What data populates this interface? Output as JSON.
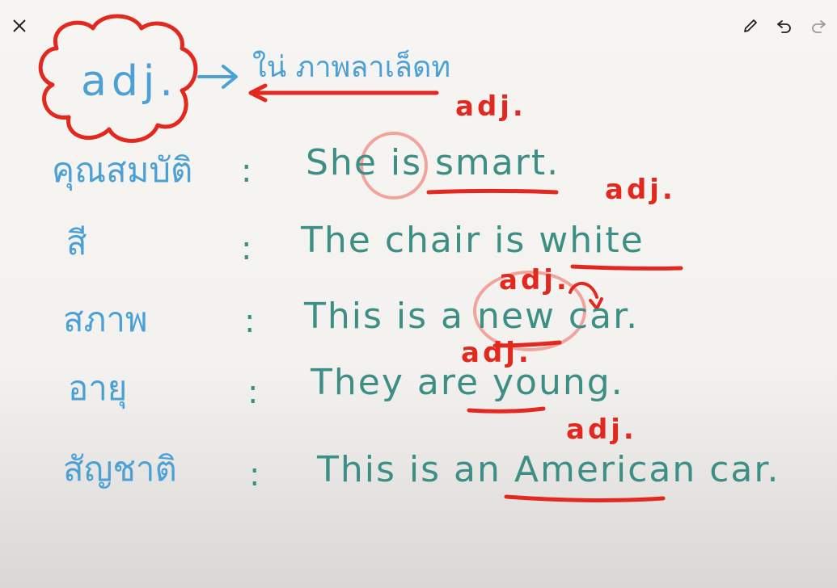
{
  "toolbar": {
    "close_icon": "close-icon",
    "pen_icon": "pencil-icon",
    "undo_icon": "undo-icon",
    "redo_icon": "redo-icon"
  },
  "header": {
    "term": "adj.",
    "meaning": "ใน่ ภาพลาเล็ดท"
  },
  "rows": [
    {
      "label": "คุณสมบัติ",
      "colon": ":",
      "sentence": "She is smart.",
      "adj": "adj."
    },
    {
      "label": "สี",
      "colon": ":",
      "sentence": "The chair is white",
      "adj": "adj."
    },
    {
      "label": "สภาพ",
      "colon": ":",
      "sentence": "This is a new car.",
      "adj": "adj."
    },
    {
      "label": "อายุ",
      "colon": ":",
      "sentence": "They are young.",
      "adj": "adj."
    },
    {
      "label": "สัญชาติ",
      "colon": ":",
      "sentence": "This is an American car.",
      "adj": "adj."
    }
  ],
  "colors": {
    "blue_ink": "#4ba0d6",
    "teal_ink": "#3d8f86",
    "red_ink": "#e3281f",
    "pink_ink": "#f2a49c"
  }
}
